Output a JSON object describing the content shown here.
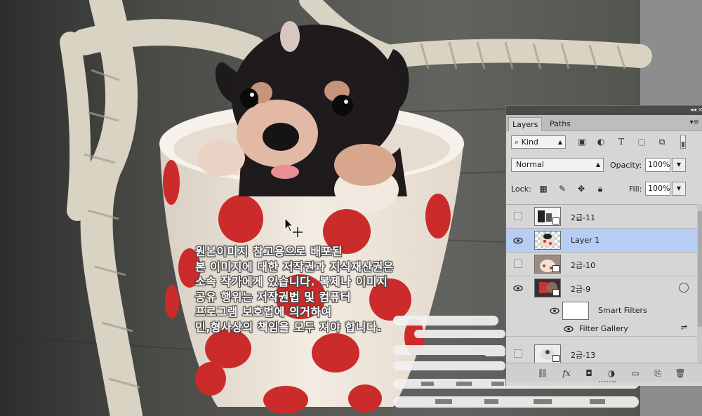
{
  "watermark_lines": [
    "원본이미지 참고용으로 배포된",
    "본 이미지에 대한 저작권과 지식재산권은",
    "소속 작가에게 있습니다. 복제나 이미지",
    "공유 행위는 저작권법 및 컴퓨터",
    "프로그램 보호법에 의거하여",
    "민,형사상의 책임을 모두 져야 합니다."
  ],
  "panel": {
    "tabs": [
      "Layers",
      "Paths"
    ],
    "filter": {
      "kind_label": "Kind",
      "icons": [
        "image-filter-icon",
        "adjustment-filter-icon",
        "type-filter-icon",
        "shape-filter-icon",
        "smart-object-filter-icon"
      ]
    },
    "blend_mode": "Normal",
    "opacity_label": "Opacity:",
    "opacity_value": "100%",
    "lock_label": "Lock:",
    "fill_label": "Fill:",
    "fill_value": "100%",
    "layers": [
      {
        "name": "2급-11",
        "visible": false,
        "selected": false
      },
      {
        "name": "Layer 1",
        "visible": true,
        "selected": true
      },
      {
        "name": "2급-10",
        "visible": false,
        "selected": false
      },
      {
        "name": "2급-9",
        "visible": true,
        "selected": false
      },
      {
        "name": "2급-13",
        "visible": false,
        "selected": false
      }
    ],
    "smart_filters_label": "Smart Filters",
    "filter_gallery_label": "Filter Gallery"
  },
  "colors": {
    "selected_layer": "#b7cdf3",
    "panel_bg": "#d6d6d6"
  }
}
